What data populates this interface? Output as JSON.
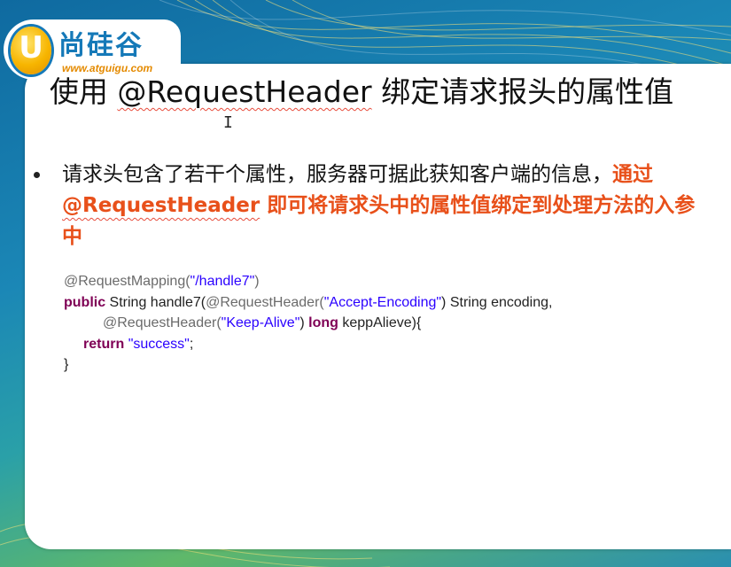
{
  "brand": {
    "logo_letter": "U",
    "logo_name": "尚硅谷",
    "logo_url": "www.atguigu.com"
  },
  "slide": {
    "title_prefix": "使用 ",
    "title_annotation": "@RequestHeader",
    "title_suffix": " 绑定请求报头的属性值",
    "bullet_plain": "请求头包含了若干个属性，服务器可据此获知客户端的信息，",
    "bullet_highlight_1": "通过 ",
    "bullet_highlight_2": "@RequestHeader",
    "bullet_highlight_3": " 即可将请求头中的属性值绑定到处理方法的入参中"
  },
  "code": {
    "l1_ann": "@RequestMapping(",
    "l1_str": "\"/handle7\"",
    "l1_end": ")",
    "l2_kw": "public",
    "l2_a": " String handle7(",
    "l2_ann": "@RequestHeader(",
    "l2_str": "\"Accept-Encoding\"",
    "l2_b": ") String encoding,",
    "l3_ann": "@RequestHeader(",
    "l3_str": "\"Keep-Alive\"",
    "l3_a": ") ",
    "l3_kw": "long",
    "l3_b": " keppAlieve){",
    "l4_kw": "return",
    "l4_a": " ",
    "l4_str": "\"success\"",
    "l4_b": ";",
    "l5": "}"
  },
  "colors": {
    "highlight": "#e8501a",
    "keyword": "#7f0055",
    "string": "#2a00ff",
    "annotation": "#6b6b6b"
  }
}
